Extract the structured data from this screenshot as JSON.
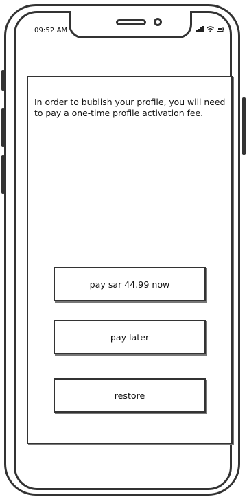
{
  "status_bar": {
    "time": "09:52 AM",
    "icons": [
      "signal-icon",
      "wifi-icon",
      "battery-icon"
    ]
  },
  "main": {
    "message": "In order to bublish your profile, you will need to pay a one-time profile activation fee."
  },
  "actions": {
    "pay_now_label": "pay sar 44.99 now",
    "pay_later_label": "pay later",
    "restore_label": "restore"
  },
  "colors": {
    "line": "#333333",
    "shadow": "#777777",
    "background": "#ffffff",
    "text": "#111111"
  }
}
